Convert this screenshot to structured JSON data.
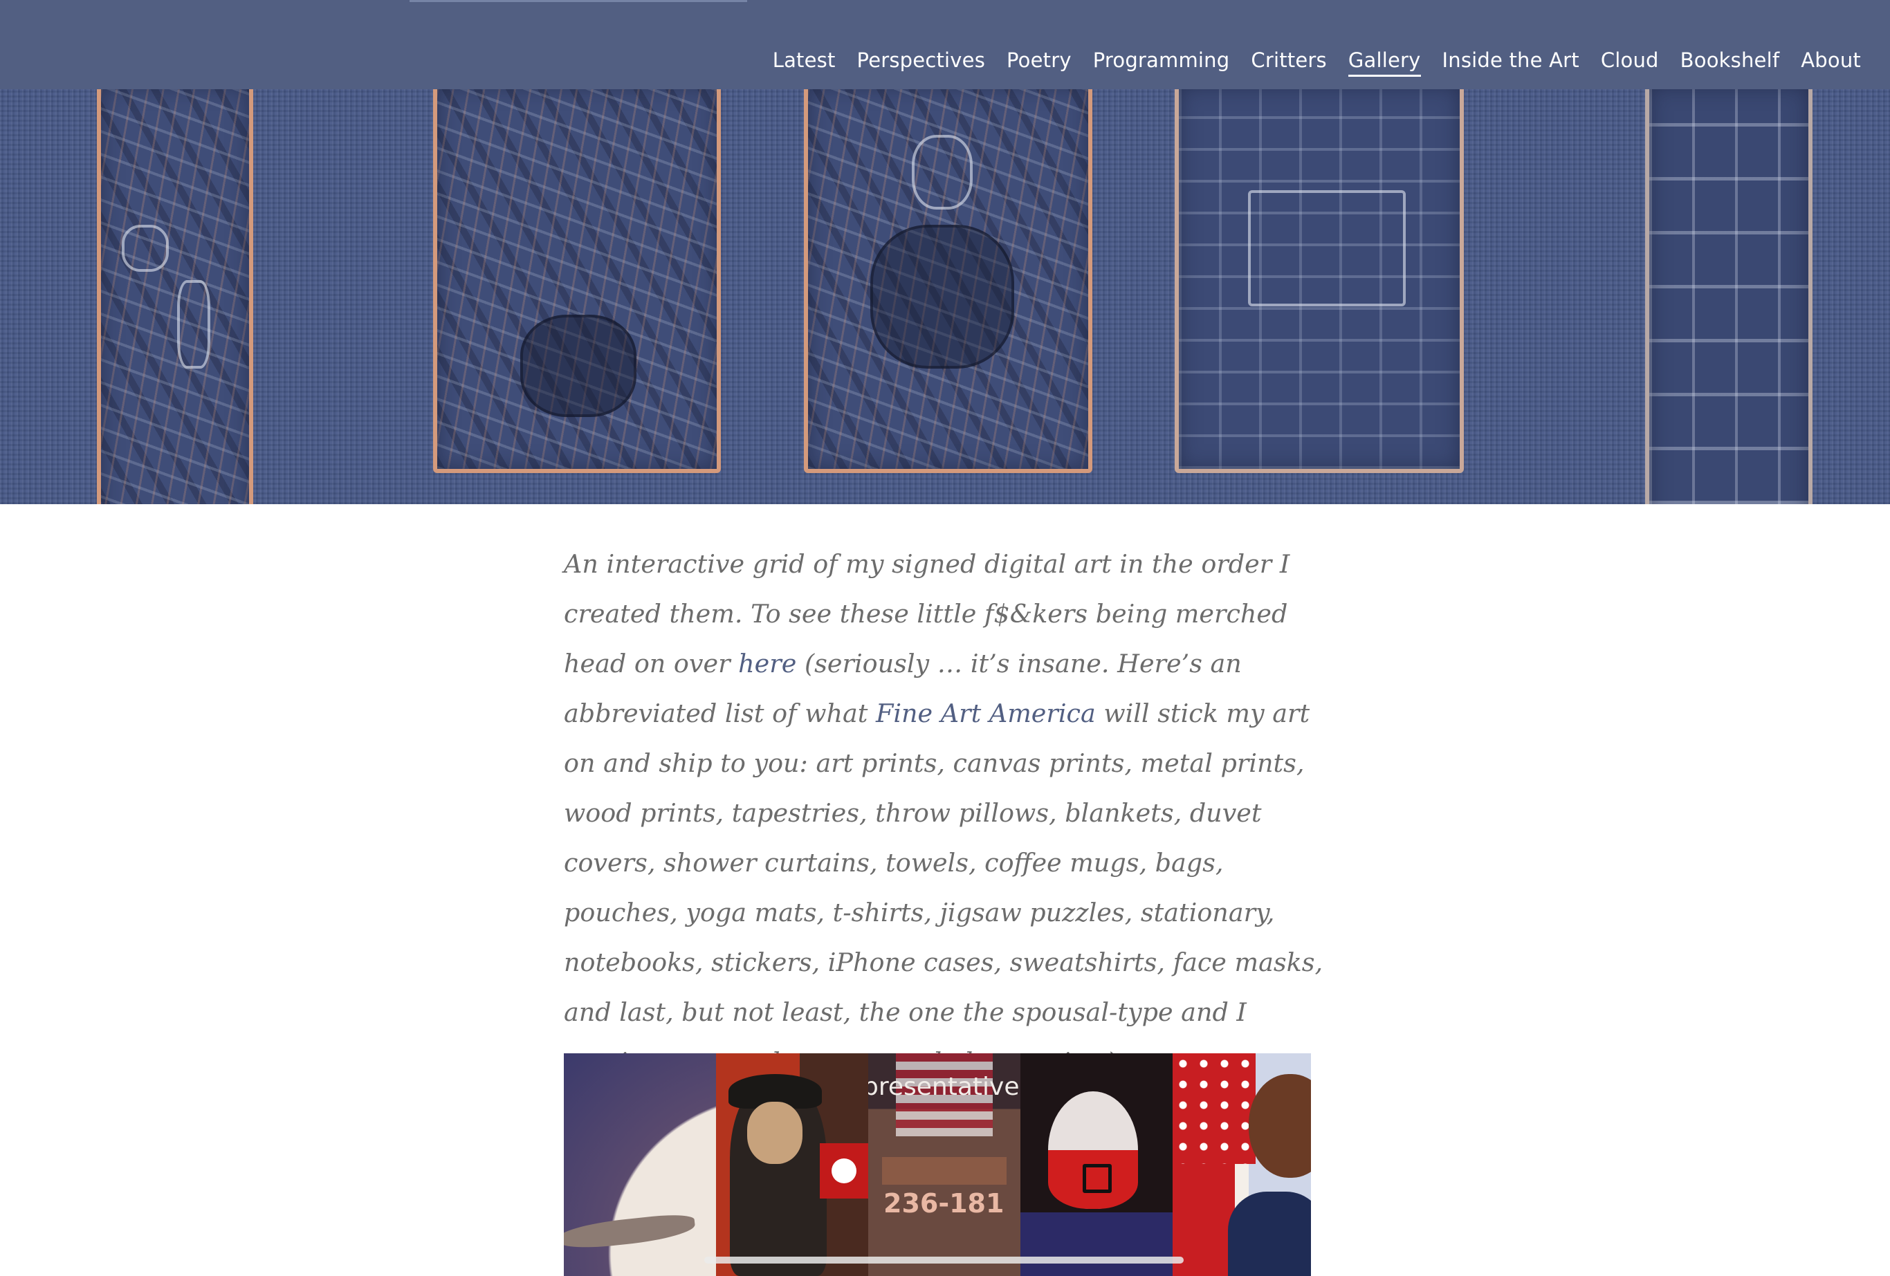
{
  "nav": {
    "items": [
      {
        "label": "Latest",
        "active": false
      },
      {
        "label": "Perspectives",
        "active": false
      },
      {
        "label": "Poetry",
        "active": false
      },
      {
        "label": "Programming",
        "active": false
      },
      {
        "label": "Critters",
        "active": false
      },
      {
        "label": "Gallery",
        "active": true
      },
      {
        "label": "Inside the Art",
        "active": false
      },
      {
        "label": "Cloud",
        "active": false
      },
      {
        "label": "Bookshelf",
        "active": false
      },
      {
        "label": "About",
        "active": false
      }
    ]
  },
  "colors": {
    "header_bg": "#525f82",
    "link": "#525f82",
    "body_text": "#6c6c6c",
    "hero_bg": "#475887"
  },
  "intro": {
    "text_1": "An interactive grid of my signed digital art in the order I created them. To see these little f$&kers being merched head on over ",
    "link_here": "here",
    "text_2": " (seriously … it’s insane. Here’s an abbreviated list of what ",
    "link_faa": "Fine Art America",
    "text_3": " will stick my art on and ship to you: art prints, canvas prints, metal prints, wood prints, tapestries, throw pillows, blankets, duvet covers, shower curtains, towels, coffee mugs, bags, pouches, yoga mats, t-shirts, jigsaw puzzles, stationary, notebooks, stickers, iPhone cases, sweatshirts, face masks, and last, but not least, the one the spousal-type and I continue to crack up over … baby onesies.)"
  },
  "gallery": {
    "tile_3_caption": "presentative",
    "tile_3_number": "236-181"
  }
}
